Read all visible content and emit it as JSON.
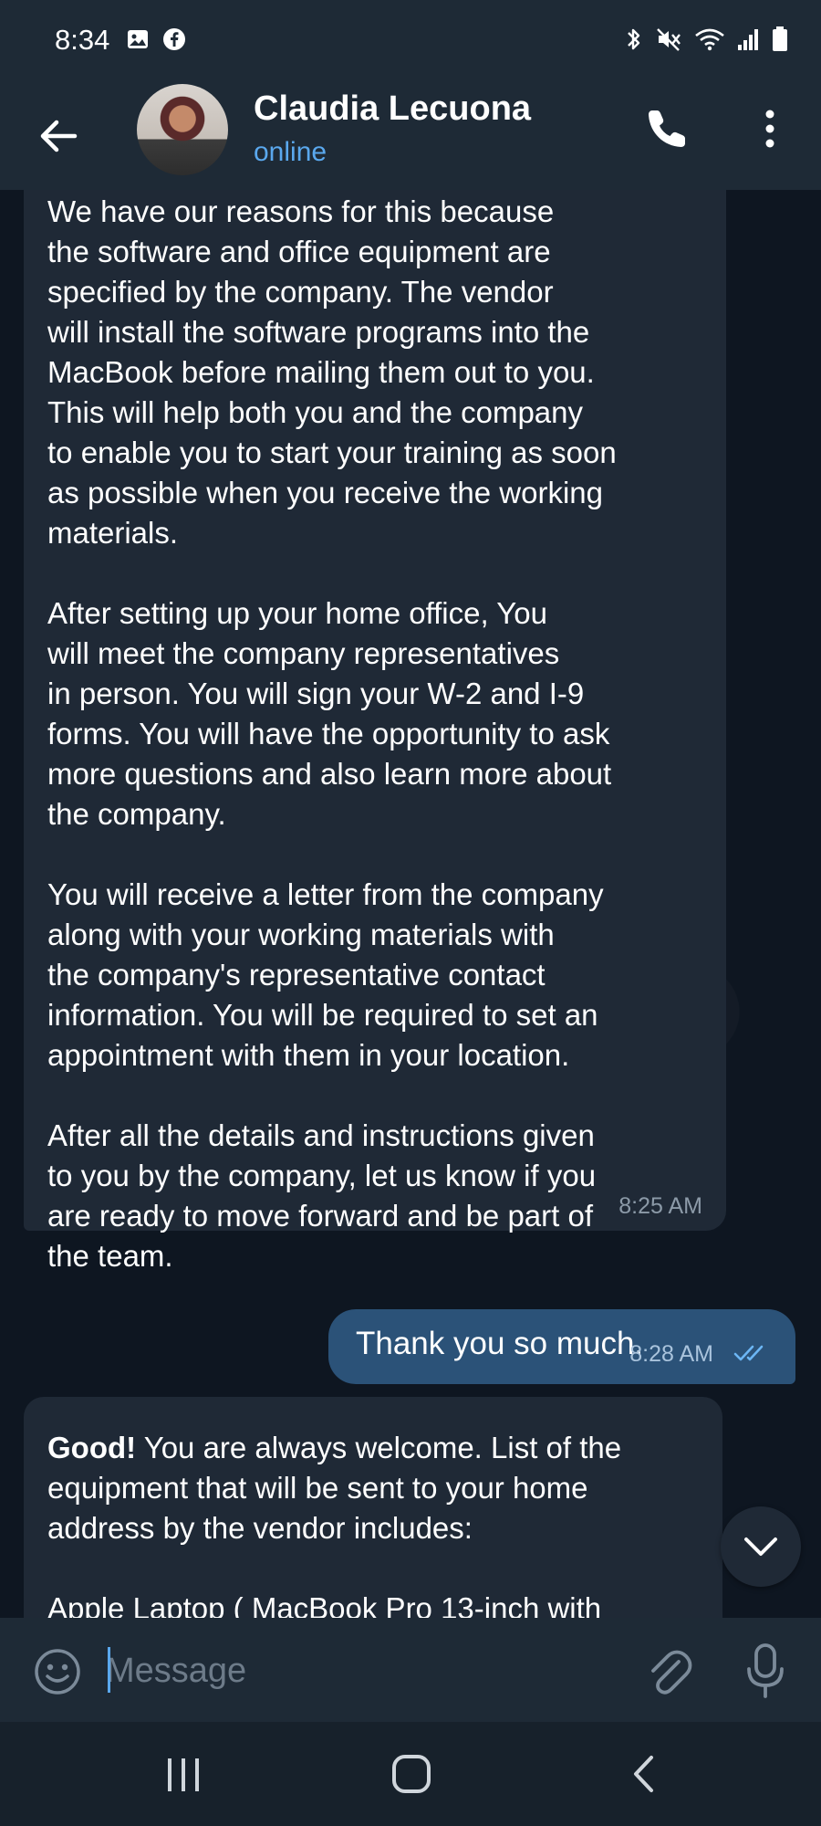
{
  "status_bar": {
    "time": "8:34",
    "left_icons": [
      "gallery-icon",
      "facebook-icon"
    ],
    "right_icons": [
      "bluetooth-icon",
      "mute-icon",
      "wifi-icon",
      "signal-icon",
      "battery-icon"
    ]
  },
  "header": {
    "contact_name": "Claudia Lecuona",
    "contact_status": "online",
    "actions": [
      "back-arrow-icon",
      "phone-icon",
      "more-vert-icon"
    ]
  },
  "messages": [
    {
      "direction": "incoming",
      "text": "We have our reasons for this because\nthe software and office equipment are\nspecified by the company. The vendor\nwill install the software programs into the\nMacBook before mailing them out to you.\nThis will help both you and the company\nto enable you to start your training as soon\nas possible when you receive the working\nmaterials.\n\nAfter setting up your home office, You\nwill meet the company representatives\nin person. You will sign your W-2 and I-9\nforms. You will have the opportunity to ask\nmore questions and also learn more about\nthe company.\n\nYou will receive a letter from the company\nalong with your working materials with\nthe company's representative contact\ninformation. You will be required to set an\nappointment with them in your location.\n\nAfter all the details and instructions given\nto you by the company, let us know if you\nare ready to move forward and be part of\nthe team.",
      "time": "8:25 AM"
    },
    {
      "direction": "outgoing",
      "text": "Thank you so much.",
      "time": "8:28 AM",
      "status": "read"
    },
    {
      "direction": "incoming",
      "bold_prefix": "Good!",
      "text": " You are always welcome. List of the\nequipment that will be sent to your home\naddress by the vendor includes:\n\nApple Laptop ( MacBook Pro 13-inch with"
    }
  ],
  "composer": {
    "placeholder": "Message",
    "value": ""
  },
  "colors": {
    "header_bg": "#1e2a36",
    "chat_bg": "#0e1621",
    "incoming_bubble": "#1f2936",
    "outgoing_bubble": "#2b5278",
    "accent": "#5aa8ee"
  }
}
